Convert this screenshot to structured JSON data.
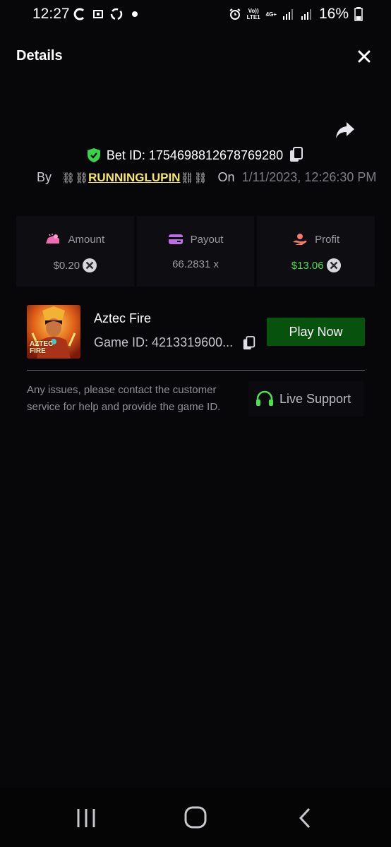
{
  "status_bar": {
    "time": "12:27",
    "battery": "16%",
    "network_top": "Vo))",
    "network_bottom": "LTE1",
    "data_type": "4G+",
    "icons": [
      "sync-c-icon",
      "screenshot-icon",
      "recycle-icon",
      "dot-icon",
      "alarm-icon",
      "signal-icon",
      "signal-icon",
      "battery-icon"
    ]
  },
  "header": {
    "title": "Details",
    "close_icon": "close-icon",
    "share_icon": "share-icon"
  },
  "bet": {
    "label": "Bet ID: 1754698812678769280",
    "verified_icon": "shield-check-icon",
    "by_label": "By",
    "chain_left": "⛓",
    "username": "RUNNINGLUPIN",
    "chain_right": "⛓",
    "on_label": "On",
    "date": "1/11/2023, 12:26:30 PM"
  },
  "stats": [
    {
      "label": "Amount",
      "value": "$0.20",
      "icon": "amount-icon",
      "coin": true,
      "color": "#9a9aa3"
    },
    {
      "label": "Payout",
      "value": "66.2831 x",
      "icon": "card-icon",
      "coin": false,
      "color": "#9a9aa3"
    },
    {
      "label": "Profit",
      "value": "$13.06",
      "icon": "profit-hand-icon",
      "coin": true,
      "color": "#48e04f"
    }
  ],
  "game": {
    "name": "Aztec Fire",
    "id_label": "Game ID: 4213319600...",
    "thumb_text_1": "AZTEC",
    "thumb_text_2": "FIRE",
    "play_button": "Play Now"
  },
  "support": {
    "text": "Any issues, please contact the customer service for help and provide the game ID.",
    "button": "Live Support"
  },
  "colors": {
    "background": "#07070a",
    "accent_green": "#48e04f",
    "play_button": "#07520c",
    "username": "#f5e66b"
  }
}
